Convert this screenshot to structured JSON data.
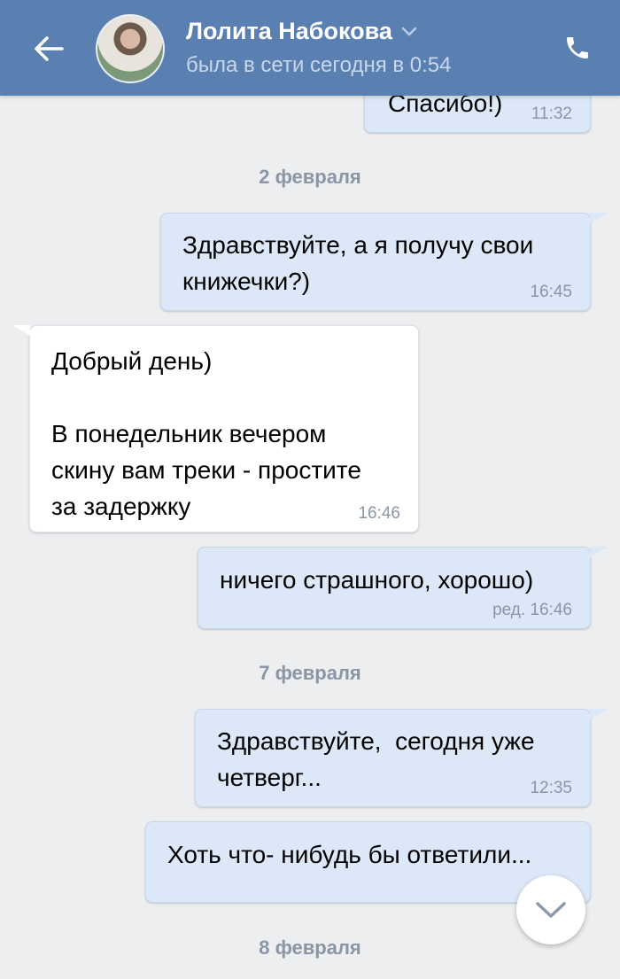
{
  "header": {
    "contact_name": "Лолита Набокова",
    "status": "была в сети сегодня в 0:54",
    "icons": {
      "back": "arrow-left-icon",
      "dropdown": "chevron-down-icon",
      "call": "phone-icon"
    },
    "colors": {
      "bar": "#5a80b2",
      "status_text": "#c9d7ea"
    }
  },
  "messages": [
    {
      "direction": "out",
      "text": "Спасибо!)",
      "time": "11:32"
    },
    {
      "date_separator": "2 февраля"
    },
    {
      "direction": "out",
      "text": "Здравствуйте, а я получу свои\nкнижечки?)",
      "time": "16:45"
    },
    {
      "direction": "in",
      "text": "Добрый день)\n\nВ понедельник вечером\nскину вам треки - простите\nза задержку",
      "time": "16:46"
    },
    {
      "direction": "out",
      "text": "ничего страшного, хорошо)",
      "time": "ред. 16:46"
    },
    {
      "date_separator": "7 февраля"
    },
    {
      "direction": "out",
      "text": "Здравствуйте,  сегодня уже\nчетверг...",
      "time": "12:35"
    },
    {
      "direction": "out",
      "text": "Хоть что- нибудь бы ответили...",
      "time": ""
    },
    {
      "date_separator": "8 февраля"
    }
  ],
  "chat": {
    "date_1": "2 февраля",
    "date_2": "7 февраля",
    "date_3": "8 февраля",
    "colors": {
      "background": "#edeef0",
      "outgoing_bubble": "#dce8f7",
      "incoming_bubble": "#ffffff",
      "meta_text": "#8a96a6"
    }
  },
  "scroll_button": {
    "icon": "chevron-down-icon"
  }
}
